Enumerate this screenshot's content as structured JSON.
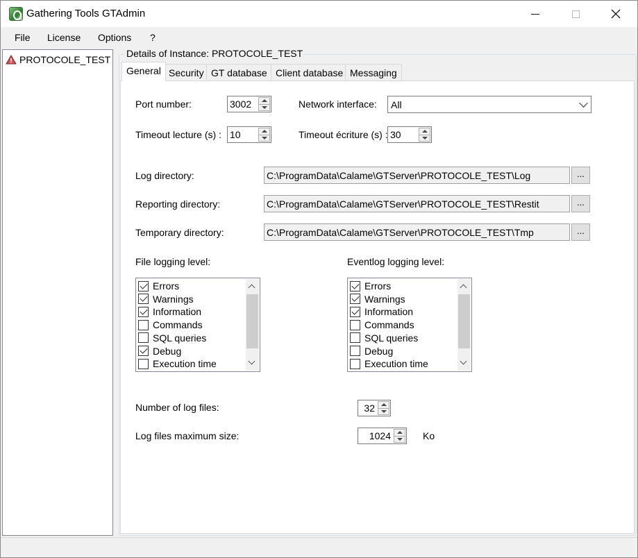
{
  "window": {
    "title": "Gathering Tools GTAdmin"
  },
  "menu": [
    "File",
    "License",
    "Options",
    "?"
  ],
  "tree": {
    "item": "PROTOCOLE_TEST"
  },
  "group_title": "Details of Instance: PROTOCOLE_TEST",
  "tabs": [
    "General",
    "Security",
    "GT database",
    "Client database",
    "Messaging"
  ],
  "general": {
    "port_label": "Port number:",
    "port_value": "3002",
    "network_label": "Network interface:",
    "network_value": "All",
    "timeout_read_label": "Timeout lecture (s) :",
    "timeout_read_value": "10",
    "timeout_write_label": "Timeout écriture (s) :",
    "timeout_write_value": "30",
    "log_dir_label": "Log directory:",
    "log_dir_value": "C:\\ProgramData\\Calame\\GTServer\\PROTOCOLE_TEST\\Log",
    "report_dir_label": "Reporting directory:",
    "report_dir_value": "C:\\ProgramData\\Calame\\GTServer\\PROTOCOLE_TEST\\Restit",
    "temp_dir_label": "Temporary directory:",
    "temp_dir_value": "C:\\ProgramData\\Calame\\GTServer\\PROTOCOLE_TEST\\Tmp",
    "browse_label": "...",
    "file_logging_label": "File logging level:",
    "eventlog_logging_label": "Eventlog logging level:",
    "file_levels": [
      {
        "label": "Errors",
        "checked": true
      },
      {
        "label": "Warnings",
        "checked": true
      },
      {
        "label": "Information",
        "checked": true
      },
      {
        "label": "Commands",
        "checked": false
      },
      {
        "label": "SQL queries",
        "checked": false
      },
      {
        "label": "Debug",
        "checked": true
      },
      {
        "label": "Execution time",
        "checked": false
      }
    ],
    "event_levels": [
      {
        "label": "Errors",
        "checked": true
      },
      {
        "label": "Warnings",
        "checked": true
      },
      {
        "label": "Information",
        "checked": true
      },
      {
        "label": "Commands",
        "checked": false
      },
      {
        "label": "SQL queries",
        "checked": false
      },
      {
        "label": "Debug",
        "checked": false
      },
      {
        "label": "Execution time",
        "checked": false
      }
    ],
    "num_log_files_label": "Number of log files:",
    "num_log_files_value": "32",
    "max_size_label": "Log files maximum size:",
    "max_size_value": "1024",
    "max_size_unit": "Ko"
  },
  "icons": {
    "app": "app-icon",
    "warning": "warning-icon"
  },
  "colors": {
    "warning_fill": "#c8585a",
    "accent": "#0078d7"
  }
}
